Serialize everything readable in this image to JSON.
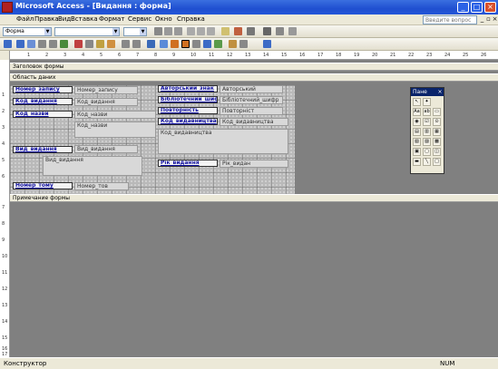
{
  "window": {
    "title": "Microsoft Access - [Видання : форма]",
    "minimize": "_",
    "maximize": "□",
    "close": "×"
  },
  "menu": {
    "items": [
      "Файл",
      "Правка",
      "Вид",
      "Вставка",
      "Формат",
      "Сервис",
      "Окно",
      "Справка"
    ],
    "help_placeholder": "Введите вопрос",
    "mdi_min": "_",
    "mdi_restore": "▫",
    "mdi_close": "×"
  },
  "toolbar": {
    "object_combo": "Форма",
    "font_combo": "",
    "size_combo": ""
  },
  "rulers": {
    "top": [
      "1",
      "2",
      "3",
      "4",
      "5",
      "6",
      "7",
      "8",
      "9",
      "10",
      "11",
      "12",
      "13",
      "14",
      "15",
      "16",
      "17",
      "18",
      "19",
      "20",
      "21",
      "22",
      "23",
      "24",
      "25",
      "26"
    ],
    "left": [
      "1",
      "2",
      "3",
      "4",
      "5",
      "6",
      "7",
      "8",
      "9",
      "10",
      "11",
      "12",
      "13",
      "14",
      "15",
      "16",
      "17",
      "18"
    ]
  },
  "sections": {
    "header": "Заголовок формы",
    "detail": "Область даних",
    "footer": "Примечание формы"
  },
  "fields": {
    "label_number": "Номер_запису",
    "box_number": "Номер_запису",
    "label_kod_vyd": "Код_видання",
    "box_kod_vyd": "Код_видання",
    "label_kod_nazvy": "Код_назви",
    "box_kod_nazvy": "Код_назви",
    "sub_kod_nazvy": "Код_назви",
    "label_vyd_vyd": "Вид_видання",
    "box_vyd_vyd": "Вид_видання",
    "sub_vyd_vyd": "Вид_видання",
    "label_number_tomu": "Номер_тому",
    "box_number_tomu": "Номер_тов",
    "label_avtorskyi": "Авторський_знак",
    "box_avtorskyi": "Авторський",
    "label_biblioteka": "Бібліотечний_шифр",
    "box_biblioteka": "Бібліотечний_шифр",
    "label_povtornist": "Повторність",
    "box_povtornist": "Повторніст",
    "label_kod_vydavnytstva": "Код_видавництва",
    "box_kod_vydavnytstva": "Код_видавництва",
    "sub_kod_vydavnytstva": "Код_видавництва",
    "label_rik": "Рік_видання",
    "box_rik": "Рік_видан"
  },
  "toolbox": {
    "title": "Пане",
    "close": "×",
    "tools": [
      "↖",
      "✦",
      "Aa",
      "ab",
      "▭",
      "◉",
      "☑",
      "⊙",
      "▤",
      "▥",
      "▦",
      "▧",
      "▨",
      "▩",
      "▣",
      "▢",
      "◫",
      "▬",
      "╲",
      "□",
      "▭"
    ]
  },
  "status": {
    "left": "Конструктор",
    "right": "NUM"
  }
}
